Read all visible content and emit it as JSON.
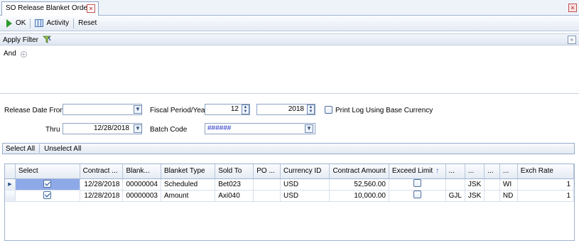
{
  "tab": {
    "title": "SO Release Blanket Orders",
    "close": "×"
  },
  "window_close": "×",
  "toolbar": {
    "ok": "OK",
    "activity": "Activity",
    "reset": "Reset"
  },
  "filter": {
    "label": "Apply Filter",
    "and_label": "And",
    "collapse": "«"
  },
  "form": {
    "release_date_from_label": "Release Date From",
    "release_date_from_value": "",
    "thru_label": "Thru",
    "thru_value": "12/28/2018",
    "fiscal_label": "Fiscal Period/Year",
    "fiscal_period": "12",
    "fiscal_year": "2018",
    "print_log_label": "Print Log Using Base Currency",
    "batch_code_label": "Batch Code",
    "batch_code_value": "######"
  },
  "selection": {
    "select_all": "Select All",
    "unselect_all": "Unselect All"
  },
  "grid": {
    "headers": [
      "Select",
      "Contract ...",
      "Blank...",
      "Blanket Type",
      "Sold To",
      "PO ...",
      "Currency ID",
      "Contract Amount",
      "Exceed Limit",
      "...",
      "...",
      "...",
      "...",
      "Exch Rate"
    ],
    "rows": [
      {
        "select": true,
        "contract_date": "12/28/2018",
        "blanket_no": "00000004",
        "blanket_type": "Scheduled",
        "sold_to": "Bet023",
        "po": "",
        "currency": "USD",
        "amount": "52,560.00",
        "exceed": false,
        "c1": "",
        "c2": "JSK",
        "c3": "",
        "c4": "WI",
        "exch_rate": "1"
      },
      {
        "select": true,
        "contract_date": "12/28/2018",
        "blanket_no": "00000003",
        "blanket_type": "Amount",
        "sold_to": "Axi040",
        "po": "",
        "currency": "USD",
        "amount": "10,000.00",
        "exceed": false,
        "c1": "GJL",
        "c2": "JSK",
        "c3": "",
        "c4": "ND",
        "exch_rate": "1"
      }
    ]
  }
}
